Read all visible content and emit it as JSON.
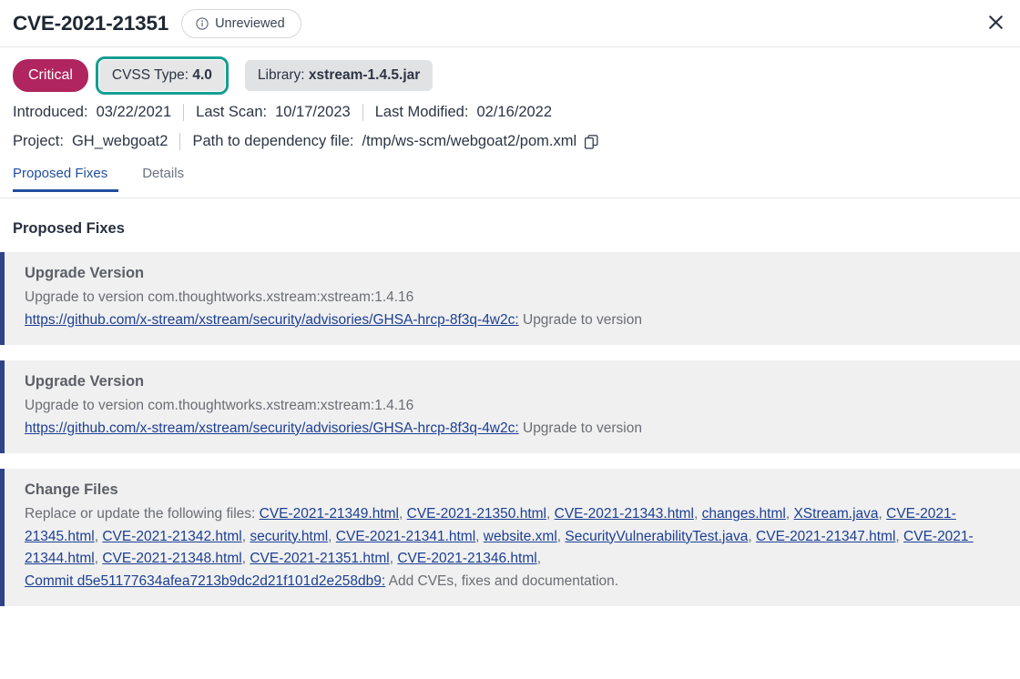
{
  "header": {
    "title": "CVE-2021-21351",
    "status_badge": {
      "label": "Unreviewed",
      "icon": "info-circle-icon"
    },
    "close_icon": "close-icon"
  },
  "chips": {
    "severity": {
      "label": "Critical",
      "color": "#b0255f"
    },
    "cvss": {
      "prefix": "CVSS Type:",
      "value": "4.0",
      "focus_ring_color": "#159e93",
      "focused": true
    },
    "library": {
      "prefix": "Library:",
      "value": "xstream-1.4.5.jar"
    }
  },
  "meta": {
    "row1": [
      {
        "label": "Introduced:",
        "value": "03/22/2021"
      },
      {
        "label": "Last Scan:",
        "value": "10/17/2023"
      },
      {
        "label": "Last Modified:",
        "value": "02/16/2022"
      }
    ],
    "row2": [
      {
        "label": "Project:",
        "value": "GH_webgoat2"
      },
      {
        "label": "Path to dependency file:",
        "value": "/tmp/ws-scm/webgoat2/pom.xml"
      }
    ],
    "copy_icon": "copy-icon"
  },
  "tabs": [
    {
      "label": "Proposed Fixes",
      "active": true
    },
    {
      "label": "Details",
      "active": false
    }
  ],
  "main": {
    "section_title": "Proposed Fixes",
    "cards": [
      {
        "title": "Upgrade Version",
        "line1": "Upgrade to version com.thoughtworks.xstream:xstream:1.4.16",
        "link": "https://github.com/x-stream/xstream/security/advisories/GHSA-hrcp-8f3q-4w2c:",
        "trail": " Upgrade to version"
      },
      {
        "title": "Upgrade Version",
        "line1": "Upgrade to version com.thoughtworks.xstream:xstream:1.4.16",
        "link": "https://github.com/x-stream/xstream/security/advisories/GHSA-hrcp-8f3q-4w2c:",
        "trail": " Upgrade to version"
      },
      {
        "title": "Change Files",
        "lead": "Replace or update the following files: ",
        "files": [
          "CVE-2021-21349.html",
          "CVE-2021-21350.html",
          "CVE-2021-21343.html",
          "changes.html",
          "XStream.java",
          "CVE-2021-21345.html",
          "CVE-2021-21342.html",
          "security.html",
          "CVE-2021-21341.html",
          "website.xml",
          "SecurityVulnerabilityTest.java",
          "CVE-2021-21347.html",
          "CVE-2021-21344.html",
          "CVE-2021-21348.html",
          "CVE-2021-21351.html",
          "CVE-2021-21346.html"
        ],
        "commit_link": "Commit d5e51177634afea7213b9dc2d21f101d2e258db9:",
        "commit_trail": " Add CVEs, fixes and documentation."
      }
    ]
  }
}
